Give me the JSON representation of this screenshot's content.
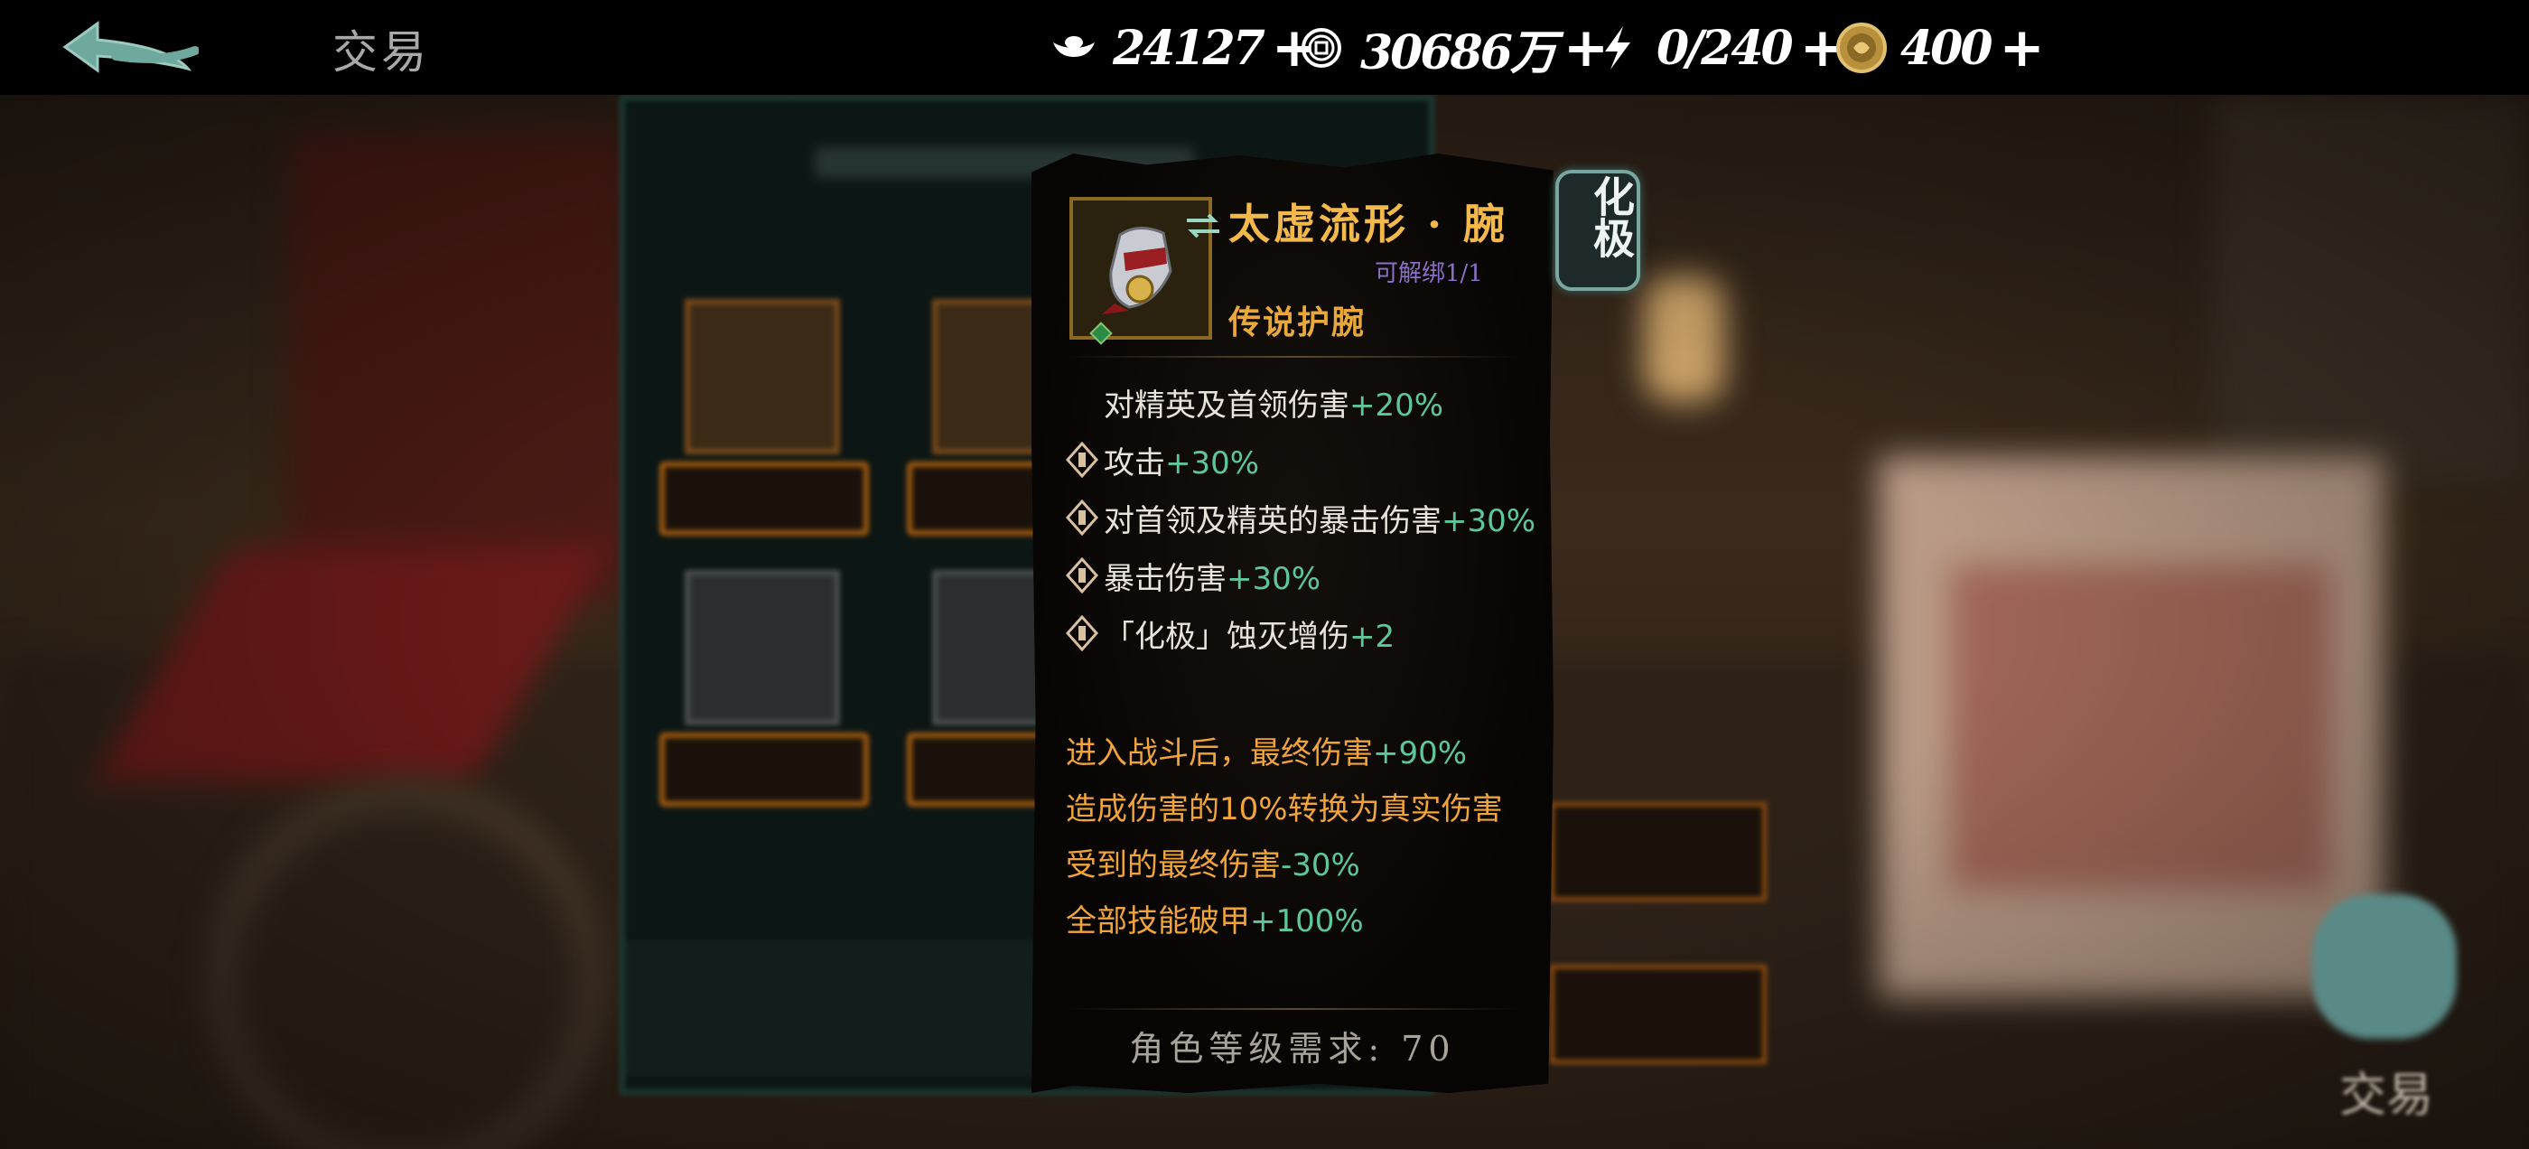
{
  "topbar": {
    "title": "交易",
    "resources": [
      {
        "icon": "silver-ingot-icon",
        "value": "24127"
      },
      {
        "icon": "copper-coin-icon",
        "value": "30686万"
      },
      {
        "icon": "lightning-icon",
        "value": "0/240"
      },
      {
        "icon": "gold-coin-icon",
        "value": "400"
      }
    ]
  },
  "tooltip": {
    "item_name": "太虚流形 · 腕",
    "bind_status": "可解绑1/1",
    "item_type": "传说护腕",
    "tier_badge": "化极",
    "stats": [
      {
        "label": "对精英及首领伤害",
        "bonus": "+20%",
        "locked": false
      },
      {
        "label": "攻击",
        "bonus": "+30%",
        "locked": true
      },
      {
        "label": "对首领及精英的暴击伤害",
        "bonus": "+30%",
        "locked": true
      },
      {
        "label": "暴击伤害",
        "bonus": "+30%",
        "locked": true
      },
      {
        "label": "「化极」蚀灭增伤",
        "bonus": "+2",
        "locked": true
      }
    ],
    "effects": [
      {
        "text": "进入战斗后，最终伤害",
        "bonus": "+90%"
      },
      {
        "pre": "造成伤害的",
        "mid": "10%",
        "post": "转换为真实伤害"
      },
      {
        "text": "受到的最终伤害",
        "bonus": "-30%"
      },
      {
        "text": "全部技能破甲",
        "bonus": "+100%"
      }
    ],
    "requirement": "角色等级需求: 70"
  },
  "background": {
    "right_label": "交易"
  },
  "colors": {
    "name_gold": "#f3b94a",
    "bonus_green": "#5ec79a",
    "effect_orange": "#f0a43a",
    "bind_purple": "#8b6fc8"
  }
}
